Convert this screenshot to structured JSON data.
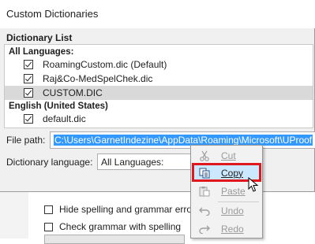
{
  "dialog": {
    "title": "Custom Dictionaries",
    "list_label": "Dictionary List",
    "groups": [
      {
        "name": "All Languages:",
        "items": [
          {
            "label": "RoamingCustom.dic (Default)",
            "checked": true
          },
          {
            "label": "Raj&Co-MedSpelChek.dic",
            "checked": true
          },
          {
            "label": "CUSTOM.DIC",
            "checked": true,
            "selected": true
          }
        ]
      },
      {
        "name": "English (United States)",
        "items": [
          {
            "label": "default.dic",
            "checked": true
          }
        ]
      }
    ],
    "file_path_label": "File path:",
    "file_path_value": "C:\\Users\\GarnetIndezine\\AppData\\Roaming\\Microsoft\\UProof",
    "dictionary_language_label": "Dictionary language:",
    "dictionary_language_value": "All Languages:"
  },
  "background": {
    "options": [
      {
        "label": "Hide spelling and grammar erro",
        "checked": false
      },
      {
        "label": "Check grammar with spelling",
        "checked": false
      }
    ]
  },
  "context_menu": {
    "items": [
      {
        "label": "Cut",
        "enabled": false,
        "icon": "scissors-icon"
      },
      {
        "label": "Copy",
        "enabled": true,
        "highlighted": true,
        "icon": "copy-icon"
      },
      {
        "label": "Paste",
        "enabled": false,
        "icon": "paste-icon"
      },
      {
        "label": "Undo",
        "enabled": false,
        "icon": "undo-icon"
      },
      {
        "label": "Redo",
        "enabled": false,
        "icon": "redo-icon"
      }
    ],
    "highlight_color": "#e0171d"
  }
}
